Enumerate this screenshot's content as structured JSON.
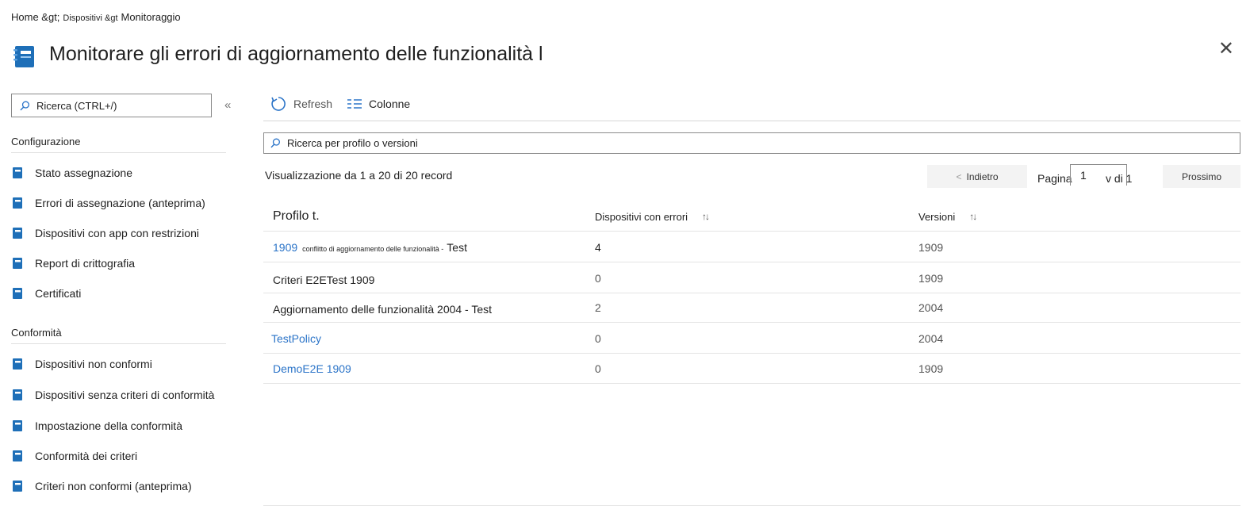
{
  "breadcrumb": {
    "home": "Home &gt;",
    "devices": "Dispositivi &gt",
    "current": "Monitoraggio"
  },
  "header": {
    "title": "Monitorare gli errori di aggiornamento delle funzionalità l",
    "icon": "notebook-icon"
  },
  "sidebar": {
    "search_placeholder": "Ricerca (CTRL+/)",
    "groups": [
      {
        "title": "Configurazione",
        "items": [
          {
            "label": "Stato assegnazione"
          },
          {
            "label": "Errori di assegnazione (anteprima)"
          },
          {
            "label": "Dispositivi con app con restrizioni"
          },
          {
            "label": "Report di crittografia"
          },
          {
            "label": "Certificati"
          }
        ]
      },
      {
        "title": "Conformità",
        "items": [
          {
            "label": "Dispositivi non conformi"
          },
          {
            "label": "Dispositivi senza criteri di conformità"
          },
          {
            "label": "Impostazione della conformità"
          },
          {
            "label": "Conformità dei criteri"
          },
          {
            "label": "Criteri non conformi (anteprima)"
          }
        ]
      }
    ]
  },
  "toolbar": {
    "refresh_label": "Refresh",
    "columns_label": "Colonne"
  },
  "main": {
    "search_placeholder": "Ricerca per profilo o versioni",
    "records_text": "Visualizzazione da 1 a 20 di 20 record",
    "pager": {
      "back_label": "Indietro",
      "page_label": "Pagina",
      "page_value": "1",
      "of_label": "v di 1",
      "next_label": "Prossimo"
    },
    "columns": {
      "profile": "Profilo t.",
      "devices": "Dispositivi con errori",
      "versions": "Versioni"
    },
    "rows": [
      {
        "profile_prefix": "1909",
        "profile_small": "conflitto di aggiornamento delle funzionalità -",
        "profile_suffix": "Test",
        "devices": "4",
        "version": "1909"
      },
      {
        "profile": "Criteri E2ETest 1909",
        "devices": "0",
        "version": "1909"
      },
      {
        "profile": "Aggiornamento delle funzionalità 2004 - Test",
        "devices": "2",
        "version": "2004"
      },
      {
        "profile": "TestPolicy",
        "devices": "0",
        "version": "2004"
      },
      {
        "profile": "DemoE2E 1909",
        "devices": "0",
        "version": "1909"
      }
    ]
  },
  "colors": {
    "link": "#2b74c8",
    "icon_blue": "#1e6fb8"
  }
}
